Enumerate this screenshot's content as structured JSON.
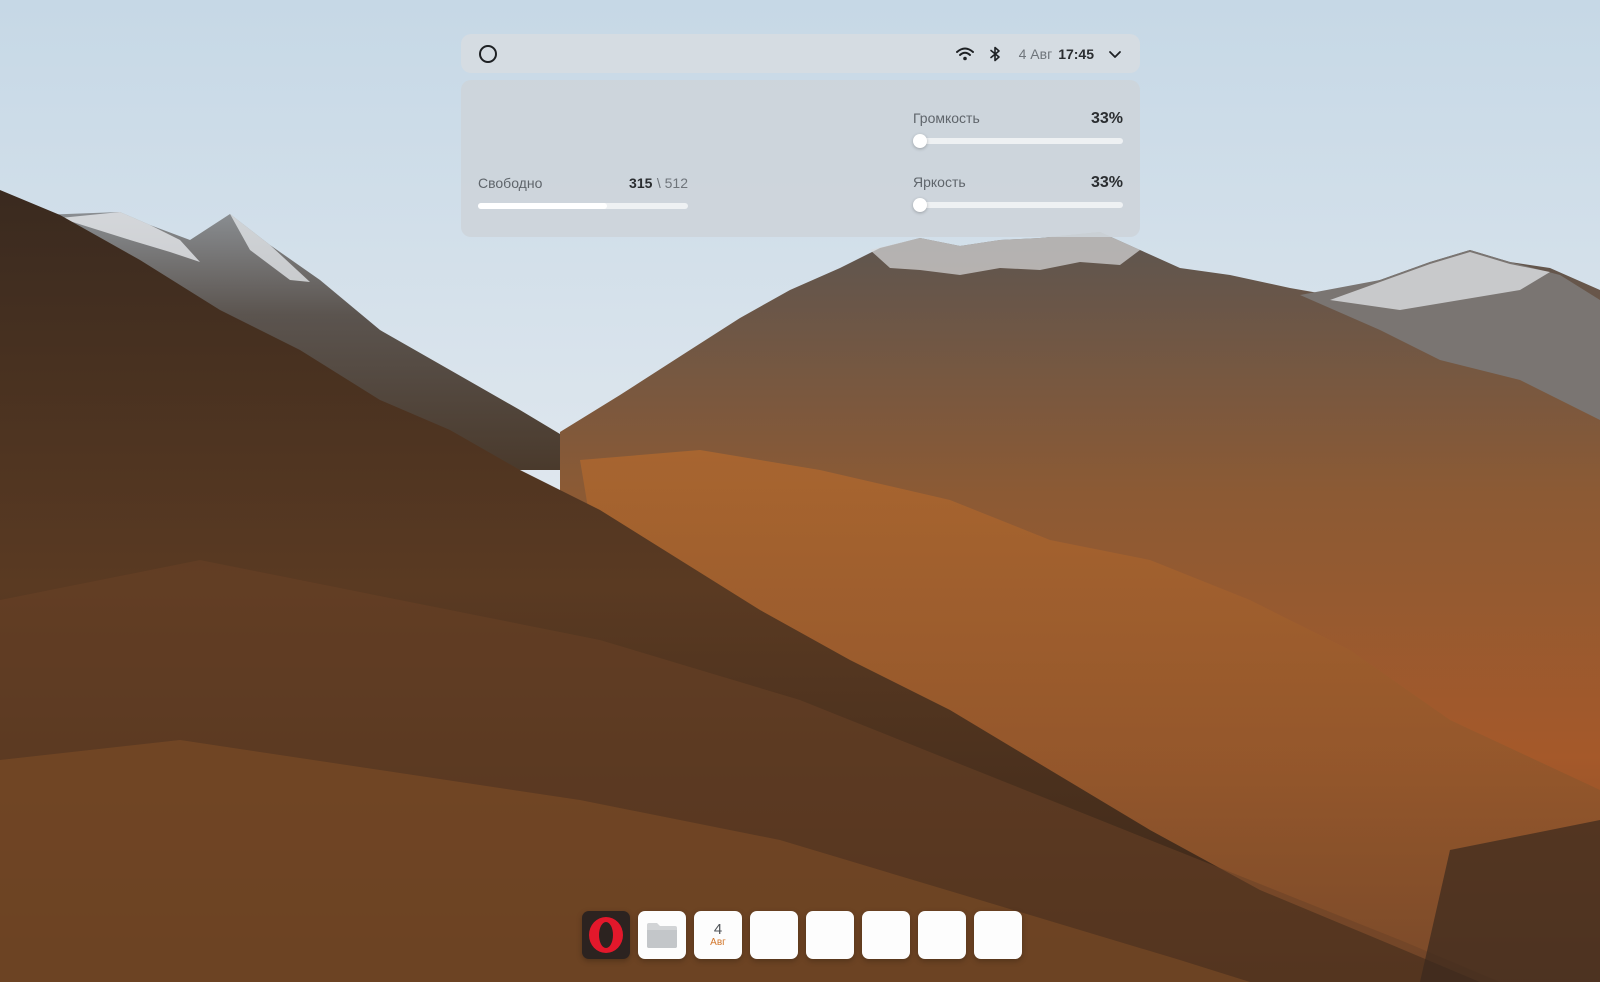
{
  "topbar": {
    "logo_icon": "circle-logo-icon",
    "wifi_icon": "wifi-icon",
    "bluetooth_icon": "bluetooth-icon",
    "date": "4 Авг",
    "time": "17:45",
    "menu_icon": "chevron-down-icon"
  },
  "panel": {
    "storage": {
      "label": "Свободно",
      "used": "315",
      "total": "\\ 512",
      "fraction": 0.615
    },
    "volume": {
      "label": "Громкость",
      "value": "33%",
      "level": 0.0
    },
    "brightness": {
      "label": "Яркость",
      "value": "33%",
      "level": 0.0
    }
  },
  "dock": {
    "apps": [
      {
        "name": "Opera",
        "icon": "opera-icon"
      },
      {
        "name": "Files",
        "icon": "folder-icon"
      },
      {
        "name": "Calendar",
        "icon": "calendar-icon",
        "day": "4",
        "month": "Авг"
      },
      {
        "name": "",
        "icon": "blank-app-icon"
      },
      {
        "name": "",
        "icon": "blank-app-icon"
      },
      {
        "name": "",
        "icon": "blank-app-icon"
      },
      {
        "name": "",
        "icon": "blank-app-icon"
      },
      {
        "name": "",
        "icon": "blank-app-icon"
      }
    ]
  },
  "colors": {
    "accent_orange": "#d2762b",
    "opera_red": "#e3182b"
  }
}
